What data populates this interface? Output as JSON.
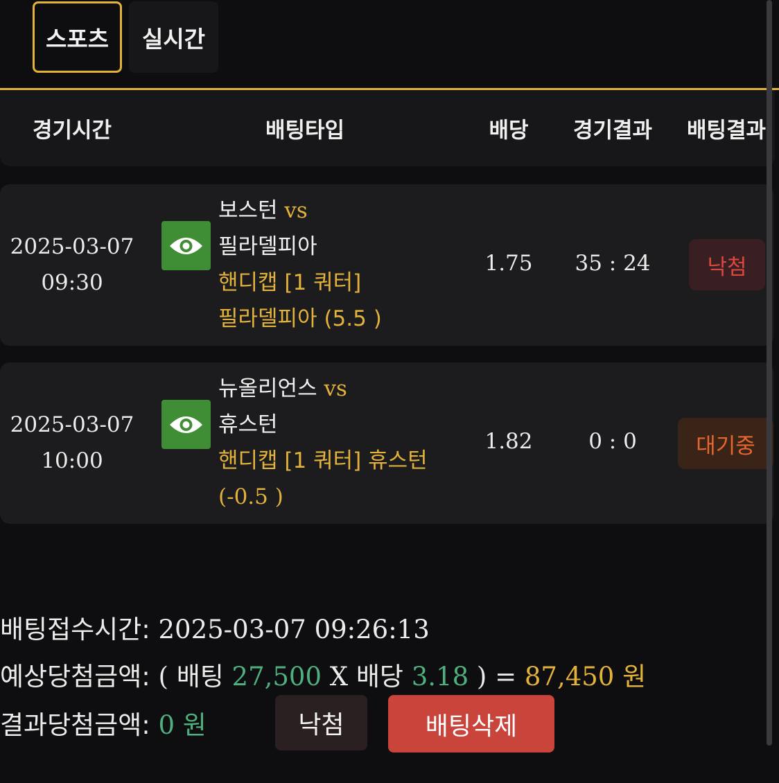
{
  "tabs": [
    {
      "label": "스포츠",
      "active": true
    },
    {
      "label": "실시간",
      "active": false
    }
  ],
  "columns": [
    "경기시간",
    "배팅타입",
    "배당",
    "경기결과",
    "배팅결과"
  ],
  "rows": [
    {
      "date": "2025-03-07",
      "time": "09:30",
      "home": "보스턴",
      "vs": "vs",
      "away": "필라델피아",
      "bet_line1": "핸디캡 [1 쿼터]",
      "bet_line2": "필라델피아 (5.5 )",
      "odds": "1.75",
      "score": "35 : 24",
      "result": "낙첨"
    },
    {
      "date": "2025-03-07",
      "time": "10:00",
      "home": "뉴올리언스",
      "vs": "vs",
      "away": "휴스턴",
      "bet_line1": "핸디캡 [1 쿼터] 휴스턴",
      "bet_line2": "(-0.5 )",
      "odds": "1.82",
      "score": "0 : 0",
      "result": "대기중"
    }
  ],
  "summary": {
    "time_label": "배팅접수시간:",
    "time_value": "2025-03-07 09:26:13",
    "expected_label": "예상당첨금액:",
    "open_paren": "(",
    "bet_label": "배팅",
    "bet_amount": "27,500",
    "x": "X",
    "odds_label": "배당",
    "odds_value": "3.18",
    "close_eq": ") =",
    "expected_amount": "87,450",
    "won": "원",
    "result_label": "결과당첨금액:",
    "result_amount": "0",
    "result_won": "원"
  },
  "buttons": {
    "result": "낙첨",
    "delete": "배팅삭제"
  },
  "colors": {
    "accent": "#e3b23a",
    "green": "#4fb07f",
    "lose": "#d9483f",
    "wait": "#e8662e",
    "delete": "#c9443a"
  }
}
